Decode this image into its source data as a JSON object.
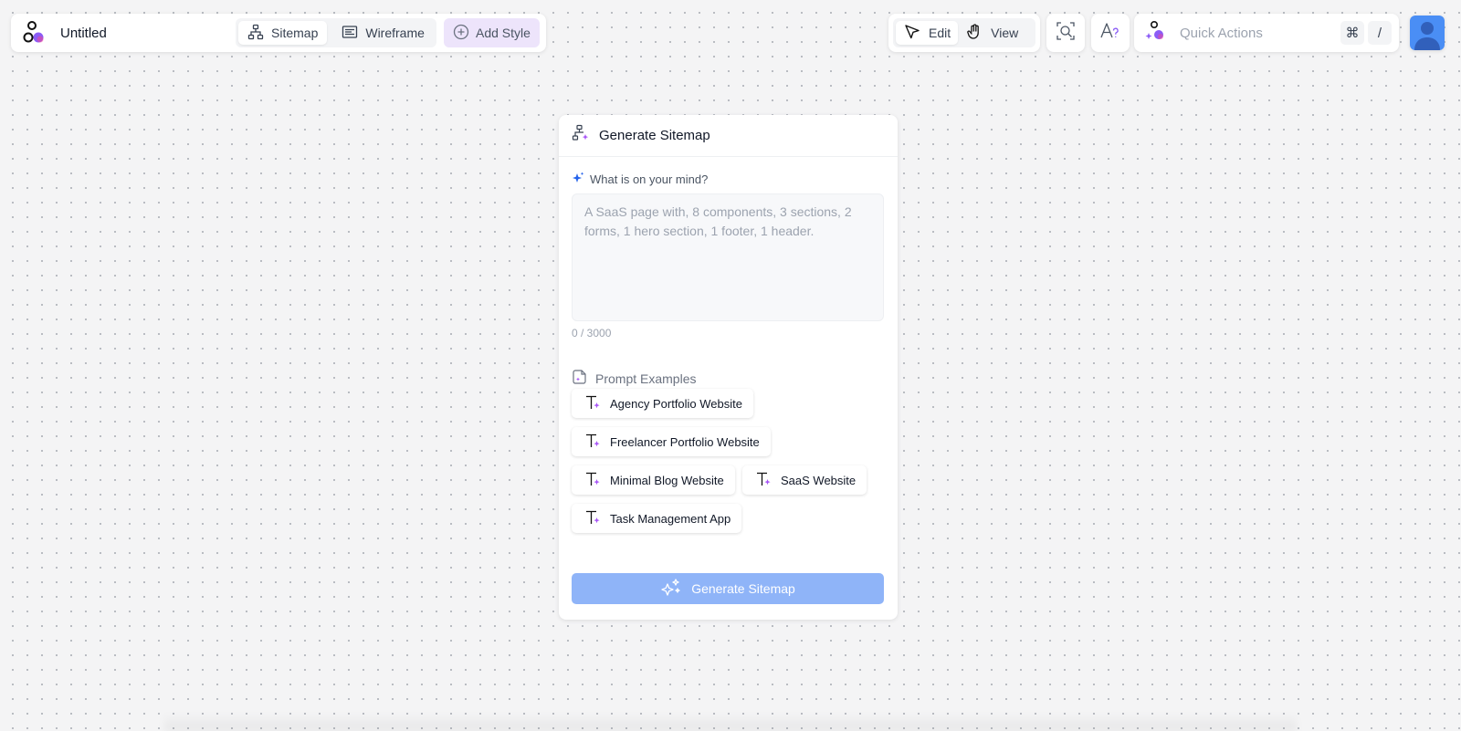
{
  "header": {
    "title": "Untitled",
    "tabs": [
      {
        "label": "Sitemap",
        "active": true,
        "icon": "sitemap-icon"
      },
      {
        "label": "Wireframe",
        "active": false,
        "icon": "wireframe-icon"
      }
    ],
    "add_style_label": "Add Style",
    "mode": {
      "edit_label": "Edit",
      "view_label": "View",
      "active": "Edit"
    },
    "quick_actions": {
      "placeholder": "Quick Actions",
      "shortcut_keys": [
        "⌘",
        "/"
      ]
    }
  },
  "panel": {
    "title": "Generate Sitemap",
    "prompt_label": "What is on your mind?",
    "prompt_placeholder": "A SaaS page with, 8 components, 3 sections, 2 forms, 1 hero section, 1 footer, 1 header.",
    "prompt_value": "",
    "char_count": "0 / 3000",
    "examples_label": "Prompt Examples",
    "examples": [
      "Agency Portfolio Website",
      "Freelancer Portfolio Website",
      "Minimal Blog Website",
      "SaaS Website",
      "Task Management App"
    ],
    "generate_label": "Generate Sitemap"
  },
  "colors": {
    "accent_blue": "#3b82f6",
    "button_disabled": "#8fb4f8",
    "add_style_bg": "#ede4fb",
    "ai_purple": "#8b5cf6"
  }
}
